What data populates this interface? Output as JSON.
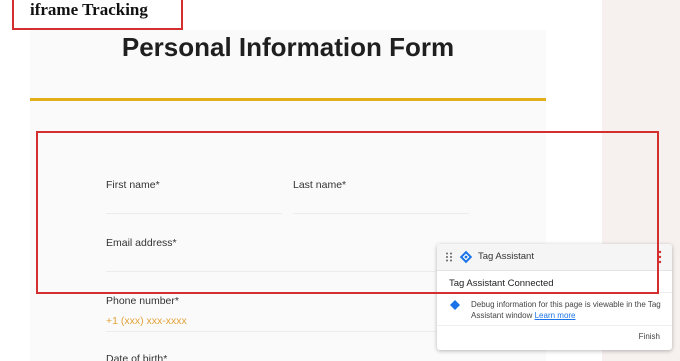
{
  "annotation": {
    "label": "iframe Tracking"
  },
  "form": {
    "title": "Personal Information Form",
    "fields": {
      "first_name": {
        "label": "First name*"
      },
      "last_name": {
        "label": "Last name*"
      },
      "email": {
        "label": "Email address*"
      },
      "phone": {
        "label": "Phone number*",
        "placeholder": "+1 (xxx) xxx-xxxx"
      },
      "dob": {
        "label": "Date of birth*"
      }
    }
  },
  "tag_assistant": {
    "title": "Tag Assistant",
    "status": "Tag Assistant Connected",
    "debug_message": "Debug information for this page is viewable in the Tag Assistant window",
    "learn_more": "Learn more",
    "finish": "Finish"
  },
  "colors": {
    "accent_rule": "#e2ae19",
    "highlight_border": "#d32f2f",
    "placeholder": "#e2a33a",
    "tag_logo": "#1a73e8",
    "link": "#1a73e8"
  },
  "icons": {
    "drag_handle": "drag-handle-icon",
    "tag_logo": "tag-assistant-logo-icon",
    "more": "more-vert-icon",
    "debug": "debug-diamond-icon"
  }
}
